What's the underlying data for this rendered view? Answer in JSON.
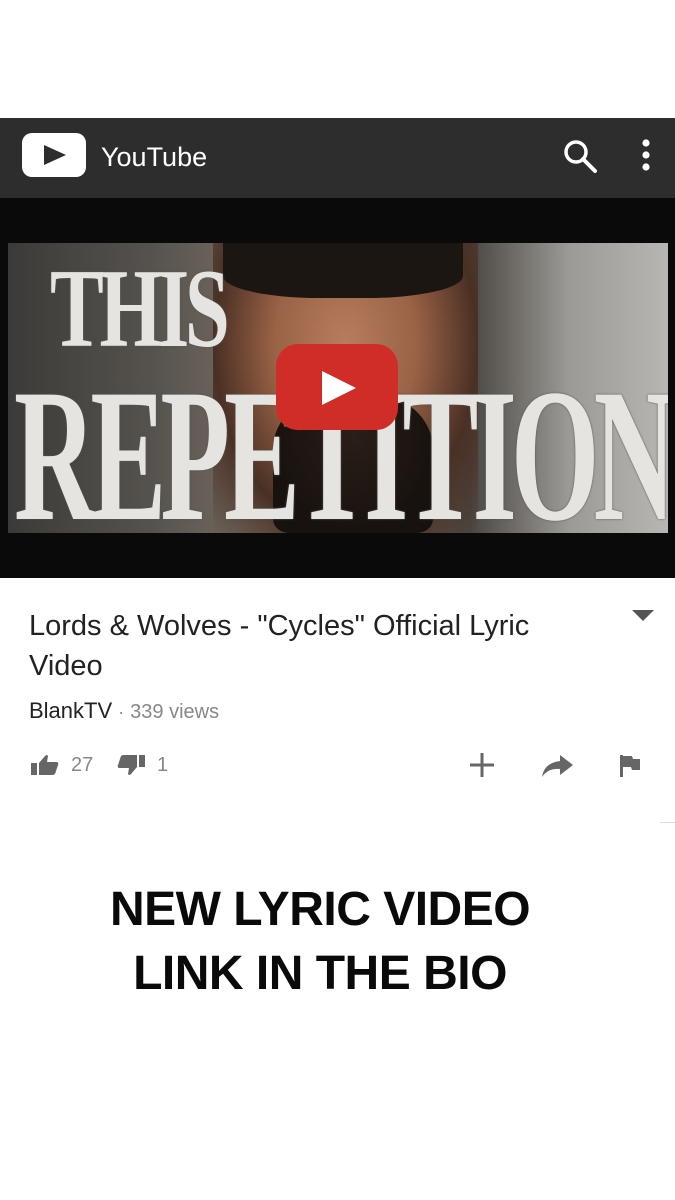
{
  "header": {
    "app_title": "YouTube",
    "logo_icon": "youtube-logo-icon",
    "search_icon": "search-icon",
    "menu_icon": "more-vert-icon",
    "background_color": "#2d2d2d"
  },
  "player": {
    "thumbnail_text_line1": "THIS",
    "thumbnail_text_line2": "REPETITION",
    "play_button_color": "#d12d28"
  },
  "video": {
    "title": "Lords & Wolves - \"Cycles\" Official Lyric Video",
    "channel": "BlankTV",
    "separator": "·",
    "views": "339 views",
    "likes": "27",
    "dislikes": "1"
  },
  "actions": [
    "add-to-playlist-icon",
    "share-icon",
    "flag-icon"
  ],
  "promo": {
    "line1": "NEW LYRIC VIDEO",
    "line2": "LINK IN THE BIO"
  }
}
